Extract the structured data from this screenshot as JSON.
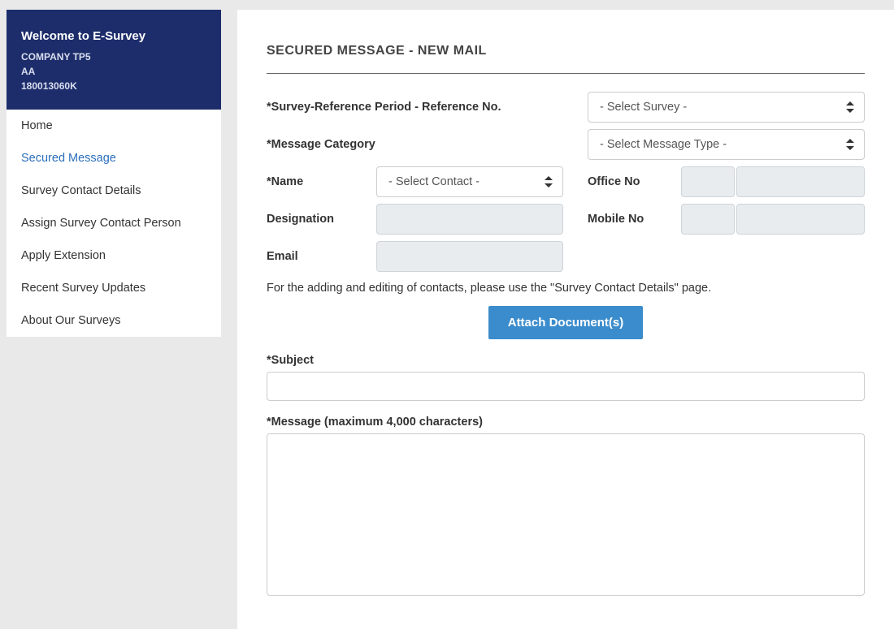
{
  "sidebar": {
    "welcome": "Welcome to E-Survey",
    "company": "COMPANY TP5",
    "code": "AA",
    "ref": "180013060K",
    "items": [
      {
        "label": "Home",
        "active": false
      },
      {
        "label": "Secured Message",
        "active": true
      },
      {
        "label": "Survey Contact Details",
        "active": false
      },
      {
        "label": "Assign Survey Contact Person",
        "active": false
      },
      {
        "label": "Apply Extension",
        "active": false
      },
      {
        "label": "Recent Survey Updates",
        "active": false
      },
      {
        "label": "About Our Surveys",
        "active": false
      }
    ]
  },
  "page": {
    "title": "SECURED MESSAGE - NEW MAIL"
  },
  "form": {
    "survey_ref_label": "*Survey-Reference Period - Reference No.",
    "survey_select": "- Select Survey -",
    "msg_cat_label": "*Message Category",
    "msg_type_select": "- Select Message Type -",
    "name_label": "*Name",
    "contact_select": "- Select Contact -",
    "designation_label": "Designation",
    "email_label": "Email",
    "office_label": "Office No",
    "mobile_label": "Mobile No",
    "helper": "For the adding and editing of contacts, please use the \"Survey Contact Details\" page.",
    "attach_label": "Attach Document(s)",
    "subject_label": "*Subject",
    "message_label": "*Message (maximum 4,000 characters)"
  }
}
